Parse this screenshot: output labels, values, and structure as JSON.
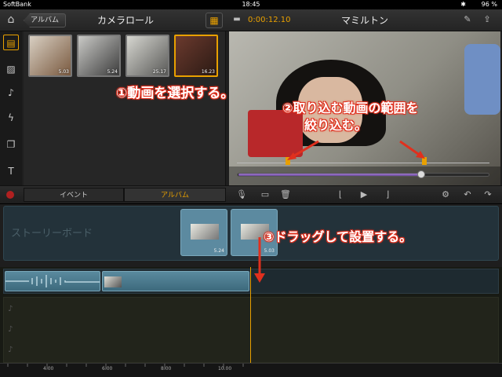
{
  "status": {
    "carrier": "SoftBank",
    "time": "18:45",
    "battery": "96 %"
  },
  "nav": {
    "back_label": "アルバム",
    "title": "カメラロール",
    "timecode": "0:00:12.10",
    "project_title": "マミルトン"
  },
  "album": {
    "thumbs": [
      {
        "duration": "5.03",
        "selected": false
      },
      {
        "duration": "5.24",
        "selected": false
      },
      {
        "duration": "25.17",
        "selected": false
      },
      {
        "duration": "16.23",
        "selected": true
      }
    ]
  },
  "tabs": {
    "event": "イベント",
    "album": "アルバム"
  },
  "storyboard": {
    "label": "ストーリーボード",
    "clips": [
      {
        "duration": "5.24"
      },
      {
        "duration": "5.03"
      }
    ]
  },
  "ruler": {
    "labels": [
      "4.00",
      "6.00",
      "8.00",
      "10.00"
    ]
  },
  "annotations": {
    "step1": "①動画を選択する。",
    "step2_line1": "②取り込む動画の範囲を",
    "step2_line2": "絞り込む。",
    "step3": "③ドラッグして設置する。"
  },
  "colors": {
    "accent": "#e8a000",
    "annotation": "#e0301e",
    "storyboard": "#23323a",
    "clip": "#5c8aa0",
    "scrub": "#8a62b8"
  }
}
